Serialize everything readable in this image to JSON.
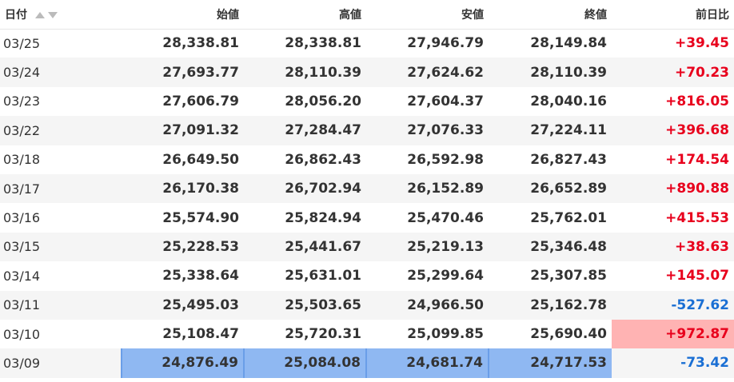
{
  "colors": {
    "positive": "#e8001c",
    "negative": "#1a6fd4",
    "highlight_red": "#ffb3b3",
    "highlight_blue": "#8fb8f2"
  },
  "header": {
    "date": "日付",
    "open": "始値",
    "high": "高値",
    "low": "安値",
    "close": "終値",
    "change": "前日比",
    "sort_icons": [
      "sort-asc-icon",
      "sort-desc-icon"
    ]
  },
  "rows": [
    {
      "date": "03/25",
      "open": "28,338.81",
      "high": "28,338.81",
      "low": "27,946.79",
      "close": "28,149.84",
      "change": "+39.45",
      "dir": "pos"
    },
    {
      "date": "03/24",
      "open": "27,693.77",
      "high": "28,110.39",
      "low": "27,624.62",
      "close": "28,110.39",
      "change": "+70.23",
      "dir": "pos"
    },
    {
      "date": "03/23",
      "open": "27,606.79",
      "high": "28,056.20",
      "low": "27,604.37",
      "close": "28,040.16",
      "change": "+816.05",
      "dir": "pos"
    },
    {
      "date": "03/22",
      "open": "27,091.32",
      "high": "27,284.47",
      "low": "27,076.33",
      "close": "27,224.11",
      "change": "+396.68",
      "dir": "pos"
    },
    {
      "date": "03/18",
      "open": "26,649.50",
      "high": "26,862.43",
      "low": "26,592.98",
      "close": "26,827.43",
      "change": "+174.54",
      "dir": "pos"
    },
    {
      "date": "03/17",
      "open": "26,170.38",
      "high": "26,702.94",
      "low": "26,152.89",
      "close": "26,652.89",
      "change": "+890.88",
      "dir": "pos"
    },
    {
      "date": "03/16",
      "open": "25,574.90",
      "high": "25,824.94",
      "low": "25,470.46",
      "close": "25,762.01",
      "change": "+415.53",
      "dir": "pos"
    },
    {
      "date": "03/15",
      "open": "25,228.53",
      "high": "25,441.67",
      "low": "25,219.13",
      "close": "25,346.48",
      "change": "+38.63",
      "dir": "pos"
    },
    {
      "date": "03/14",
      "open": "25,338.64",
      "high": "25,631.01",
      "low": "25,299.64",
      "close": "25,307.85",
      "change": "+145.07",
      "dir": "pos"
    },
    {
      "date": "03/11",
      "open": "25,495.03",
      "high": "25,503.65",
      "low": "24,966.50",
      "close": "25,162.78",
      "change": "-527.62",
      "dir": "neg"
    },
    {
      "date": "03/10",
      "open": "25,108.47",
      "high": "25,720.31",
      "low": "25,099.85",
      "close": "25,690.40",
      "change": "+972.87",
      "dir": "pos"
    },
    {
      "date": "03/09",
      "open": "24,876.49",
      "high": "25,084.08",
      "low": "24,681.74",
      "close": "24,717.53",
      "change": "-73.42",
      "dir": "neg"
    }
  ]
}
